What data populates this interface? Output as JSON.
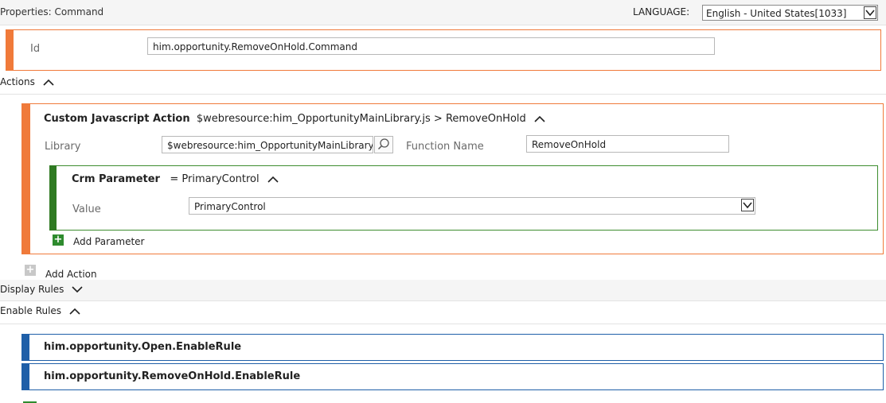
{
  "header": {
    "title": "Properties: Command",
    "language_label": "LANGUAGE:",
    "language_value": "English - United States[1033]"
  },
  "id_field": {
    "label": "Id",
    "value": "him.opportunity.RemoveOnHold.Command"
  },
  "actions_section": {
    "title": "Actions",
    "action": {
      "type": "Custom Javascript Action",
      "summary": "$webresource:him_OpportunityMainLibrary.js > RemoveOnHold",
      "library_label": "Library",
      "library_value": "$webresource:him_OpportunityMainLibrary.js",
      "function_label": "Function Name",
      "function_value": "RemoveOnHold",
      "parameter": {
        "type": "Crm Parameter",
        "summary": "= PrimaryControl",
        "value_label": "Value",
        "value": "PrimaryControl"
      },
      "add_parameter_label": "Add Parameter"
    },
    "add_action_label": "Add Action"
  },
  "display_rules": {
    "title": "Display Rules"
  },
  "enable_rules": {
    "title": "Enable Rules",
    "items": [
      {
        "name": "him.opportunity.Open.EnableRule"
      },
      {
        "name": "him.opportunity.RemoveOnHold.EnableRule"
      }
    ]
  },
  "colors": {
    "action_accent": "#f07a3a",
    "parameter_accent": "#2f7a22",
    "rule_accent": "#1f5fa8"
  },
  "icons": [
    "chevron-up-icon",
    "chevron-down-icon",
    "search-icon",
    "dropdown-arrow-icon",
    "plus-icon"
  ]
}
